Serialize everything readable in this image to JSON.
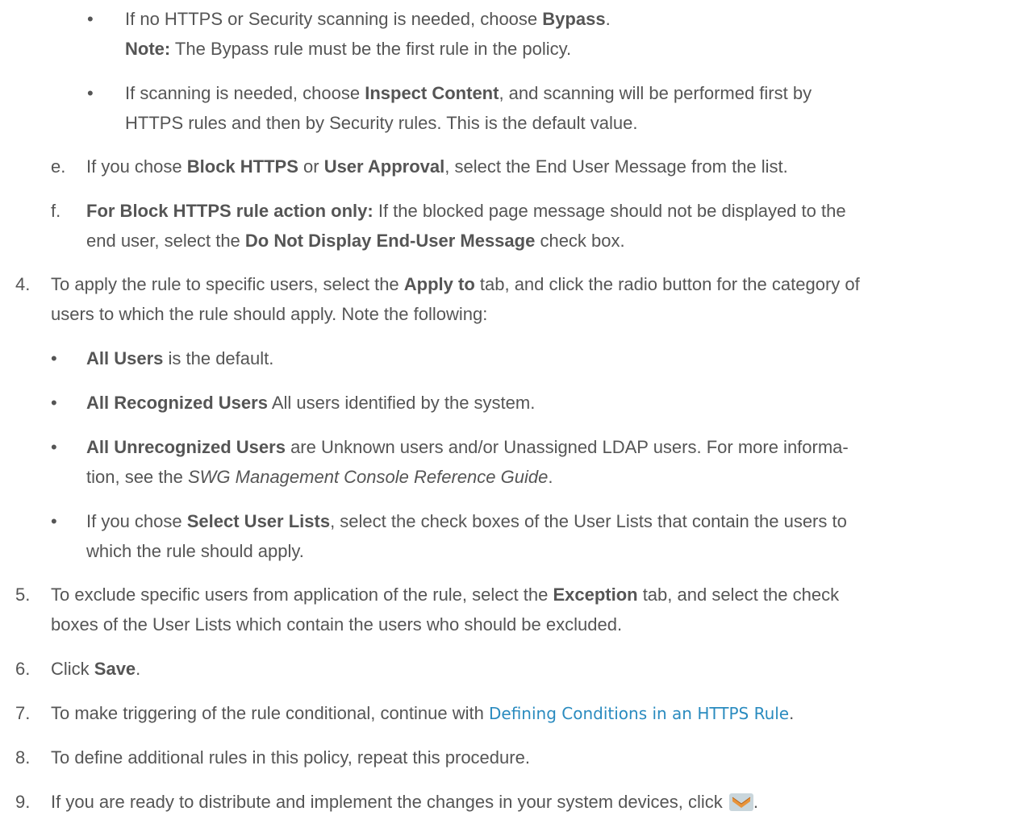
{
  "b1": {
    "bullet": "•",
    "line1_pre": "If no HTTPS or Security scanning is needed, choose ",
    "line1_bold": "Bypass",
    "line1_post": ".",
    "note_label": "Note:",
    "note_text": " The Bypass rule must be the first rule in the policy."
  },
  "b2": {
    "bullet": "•",
    "line1_pre": "If scanning is needed, choose ",
    "line1_bold": "Inspect Content",
    "line1_post": ", and scanning will be performed first by",
    "line2": "HTTPS rules and then by Security rules. This is the default value."
  },
  "e": {
    "label": "e.",
    "pre": "If you chose ",
    "bold1": "Block HTTPS",
    "mid": " or ",
    "bold2": "User Approval",
    "post": ", select the End User Message from the list."
  },
  "f": {
    "label": "f.",
    "bold1": "For Block HTTPS rule action only:",
    "line1_post": " If the blocked page message should not be displayed to the",
    "line2_pre": "end user, select the ",
    "line2_bold": "Do Not Display End-User Message",
    "line2_post": " check box."
  },
  "s4": {
    "label": "4.",
    "line1_pre": "To apply the rule to specific users, select the ",
    "line1_bold": "Apply to",
    "line1_post": " tab, and click the radio button for the category of",
    "line2": "users to which the rule should apply. Note the following:"
  },
  "s4b1": {
    "bullet": "•",
    "bold": "All Users",
    "post": " is the default."
  },
  "s4b2": {
    "bullet": "•",
    "bold": "All Recognized Users",
    "post": " All users identified by the system."
  },
  "s4b3": {
    "bullet": "•",
    "bold": "All Unrecognized Users",
    "line1_post": " are Unknown users and/or Unassigned LDAP users. For more informa-",
    "line2_pre": "tion, see the ",
    "line2_italic": "SWG Management Console Reference Guide",
    "line2_post": "."
  },
  "s4b4": {
    "bullet": "•",
    "pre": "If you chose ",
    "bold": "Select User Lists",
    "line1_post": ", select the check boxes of the User Lists that contain the users to",
    "line2": "which the rule should apply."
  },
  "s5": {
    "label": "5.",
    "line1_pre": "To exclude specific users from application of the rule, select the ",
    "line1_bold": "Exception",
    "line1_post": " tab, and select the check",
    "line2": "boxes of the User Lists which contain the users who should be excluded."
  },
  "s6": {
    "label": "6.",
    "pre": "Click ",
    "bold": "Save",
    "post": "."
  },
  "s7": {
    "label": "7.",
    "pre": "To make triggering of the rule conditional, continue with ",
    "link": "Defining Conditions in an HTTPS Rule",
    "post": "."
  },
  "s8": {
    "label": "8.",
    "text": "To define additional rules in this policy, repeat this procedure."
  },
  "s9": {
    "label": "9.",
    "pre": "If you are ready to distribute and implement the changes in your system devices, click ",
    "icon": "commit-changes-icon",
    "post": "."
  },
  "colors": {
    "text": "#555555",
    "link": "#2a8bbf",
    "icon_fill": "#e8943a",
    "icon_bg": "#c9d6dc"
  }
}
